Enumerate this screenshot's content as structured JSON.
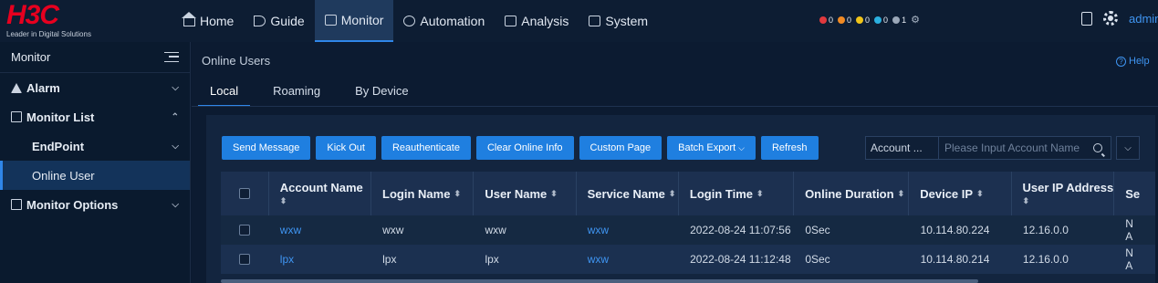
{
  "header": {
    "logo_text": "H3C",
    "logo_tagline": "Leader in Digital Solutions",
    "nav": [
      {
        "label": "Home",
        "icon": "home-icon"
      },
      {
        "label": "Guide",
        "icon": "guide-icon"
      },
      {
        "label": "Monitor",
        "icon": "monitor-icon"
      },
      {
        "label": "Automation",
        "icon": "automation-icon"
      },
      {
        "label": "Analysis",
        "icon": "analysis-icon"
      },
      {
        "label": "System",
        "icon": "system-icon"
      }
    ],
    "active_nav": "Monitor",
    "alarm_counts": [
      {
        "count": "0",
        "color": "#e0393e"
      },
      {
        "count": "0",
        "color": "#f08a24"
      },
      {
        "count": "0",
        "color": "#f0c419"
      },
      {
        "count": "0",
        "color": "#2bb0e0"
      },
      {
        "count": "1",
        "color": "#9aa7b8"
      }
    ],
    "user": "admin"
  },
  "sidebar": {
    "title": "Monitor",
    "items": {
      "alarm": "Alarm",
      "monitor_list": "Monitor List",
      "endpoint": "EndPoint",
      "online_user": "Online User",
      "monitor_options": "Monitor Options"
    }
  },
  "main": {
    "page_title": "Online Users",
    "help": "Help",
    "tabs": [
      "Local",
      "Roaming",
      "By Device"
    ],
    "active_tab": "Local",
    "toolbar": {
      "send_message": "Send Message",
      "kick_out": "Kick Out",
      "reauthenticate": "Reauthenticate",
      "clear_online_info": "Clear Online Info",
      "custom_page": "Custom Page",
      "batch_export": "Batch Export",
      "refresh": "Refresh"
    },
    "search": {
      "field": "Account ...",
      "placeholder": "Please Input Account Name"
    },
    "table": {
      "columns": [
        "Account Name",
        "Login Name",
        "User Name",
        "Service Name",
        "Login Time",
        "Online Duration",
        "Device IP",
        "User IP Address",
        "Se"
      ],
      "rows": [
        {
          "account": "wxw",
          "login": "wxw",
          "user": "wxw",
          "service": "wxw",
          "time": "2022-08-24 11:07:56",
          "duration": "0Sec",
          "device_ip": "10.114.80.224",
          "user_ip": "12.16.0.0",
          "extra_1": "N",
          "extra_2": "A"
        },
        {
          "account": "lpx",
          "login": "lpx",
          "user": "lpx",
          "service": "wxw",
          "time": "2022-08-24 11:12:48",
          "duration": "0Sec",
          "device_ip": "10.114.80.214",
          "user_ip": "12.16.0.0",
          "extra_1": "N",
          "extra_2": "A"
        }
      ]
    }
  }
}
